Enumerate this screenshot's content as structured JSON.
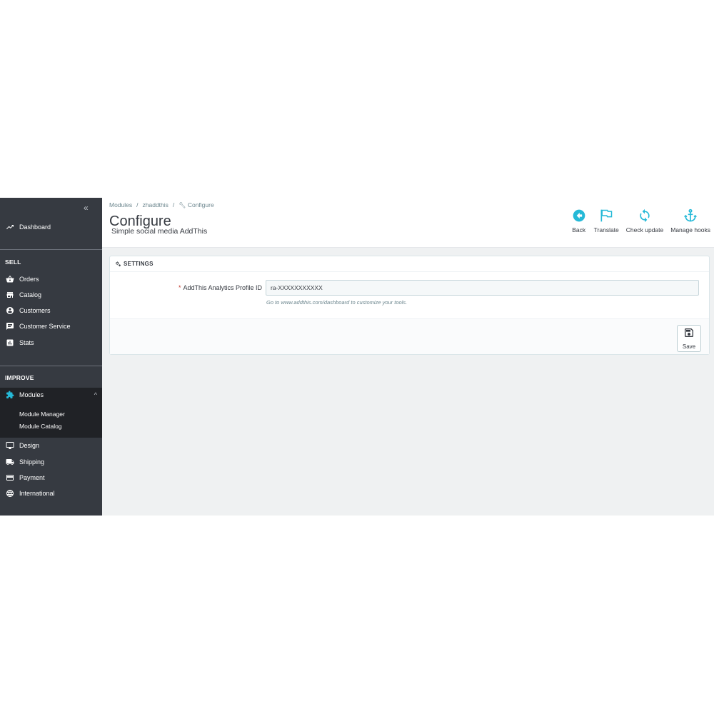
{
  "sidebar": {
    "collapse_glyph": "«",
    "dashboard": "Dashboard",
    "sections": {
      "sell": "SELL",
      "improve": "IMPROVE"
    },
    "sell_items": [
      {
        "label": "Orders",
        "icon": "basket-icon"
      },
      {
        "label": "Catalog",
        "icon": "store-icon"
      },
      {
        "label": "Customers",
        "icon": "account-icon"
      },
      {
        "label": "Customer Service",
        "icon": "chat-icon"
      },
      {
        "label": "Stats",
        "icon": "bar-chart-icon"
      }
    ],
    "modules": {
      "label": "Modules",
      "sub_items": [
        "Module Manager",
        "Module Catalog"
      ]
    },
    "improve_items": [
      {
        "label": "Design",
        "icon": "desktop-icon"
      },
      {
        "label": "Shipping",
        "icon": "truck-icon"
      },
      {
        "label": "Payment",
        "icon": "credit-card-icon"
      },
      {
        "label": "International",
        "icon": "globe-icon"
      }
    ]
  },
  "header": {
    "breadcrumb": [
      "Modules",
      "zhaddthis",
      "Configure"
    ],
    "title": "Configure",
    "subtitle": "Simple social media AddThis",
    "toolbar": [
      {
        "label": "Back",
        "icon": "back-arrow-icon"
      },
      {
        "label": "Translate",
        "icon": "flag-icon"
      },
      {
        "label": "Check update",
        "icon": "refresh-icon"
      },
      {
        "label": "Manage hooks",
        "icon": "anchor-icon"
      }
    ]
  },
  "panel": {
    "title": "SETTINGS",
    "field_label": "AddThis Analytics Profile ID",
    "required_mark": "*",
    "field_value": "ra-XXXXXXXXXXX",
    "help_text": "Go to www.addthis.com/dashboard to customize your tools.",
    "save_label": "Save"
  },
  "colors": {
    "sidebar_bg": "#363a41",
    "active_bg": "#202226",
    "accent": "#25b9d7",
    "page_bg": "#eff1f2"
  }
}
